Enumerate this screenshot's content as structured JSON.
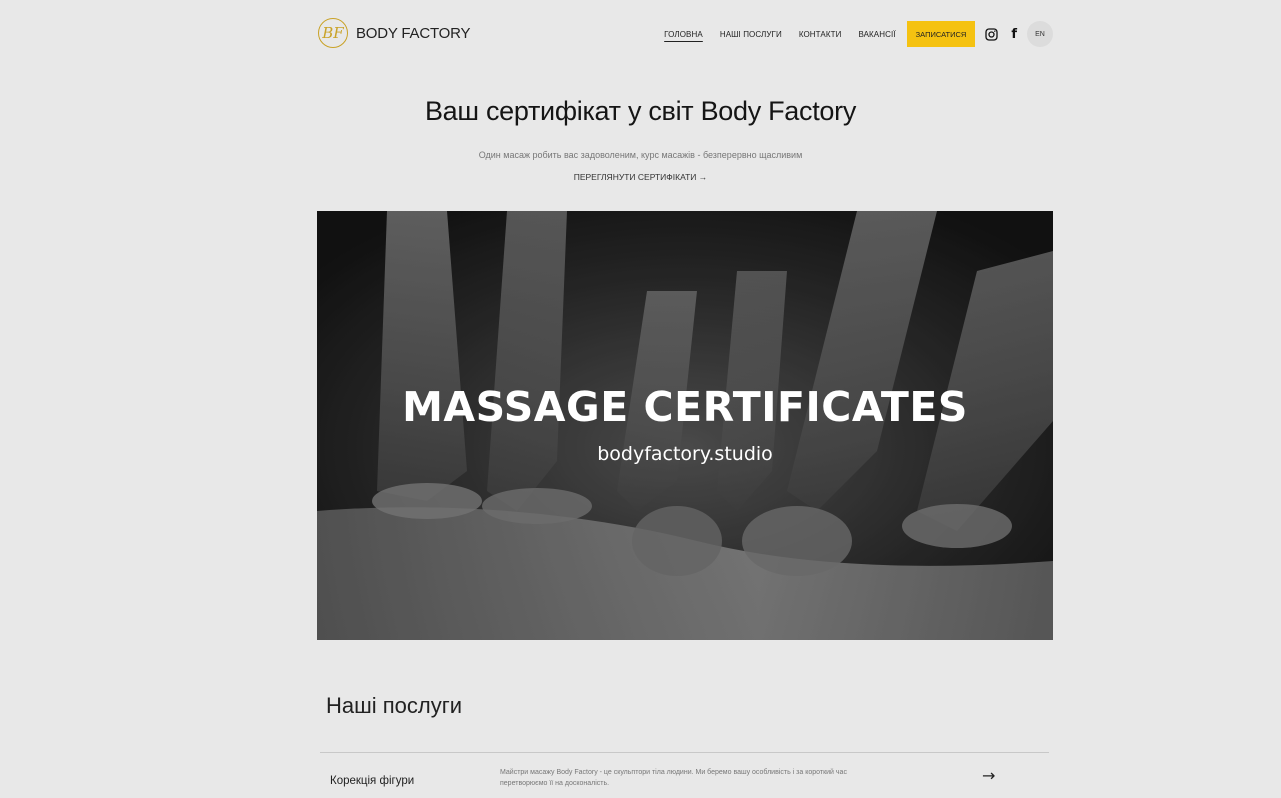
{
  "header": {
    "logo_text": "BODY FACTORY",
    "logo_monogram": "BF",
    "nav": [
      {
        "label": "ГОЛОВНА"
      },
      {
        "label": "НАШІ ПОСЛУГИ"
      },
      {
        "label": "КОНТАКТИ"
      },
      {
        "label": "ВАКАНСІЇ"
      }
    ],
    "cta_label": "ЗАПИСАТИСЯ",
    "instagram_icon": "instagram-icon",
    "facebook_glyph": "f",
    "lang_label": "EN",
    "accent_color": "#f5c211",
    "logo_color": "#c9a227"
  },
  "hero": {
    "title": "Ваш сертифікат у світ Body Factory",
    "subtitle": "Один масаж робить вас задоволеним, курс масажів - безперервно щасливим",
    "link": "ПЕРЕГЛЯНУТИ СЕРТИФІКАТИ →"
  },
  "banner": {
    "title": "MASSAGE CERTIFICATES",
    "url": "bodyfactory.studio"
  },
  "services": {
    "title": "Наші послуги",
    "items": [
      {
        "name": "Корекція фігури",
        "description": "Майстри масажу Body Factory - це скульптори тіла людини. Ми беремо вашу особливість і за короткий час перетворюємо її на досконалість.",
        "arrow": "→"
      }
    ]
  }
}
